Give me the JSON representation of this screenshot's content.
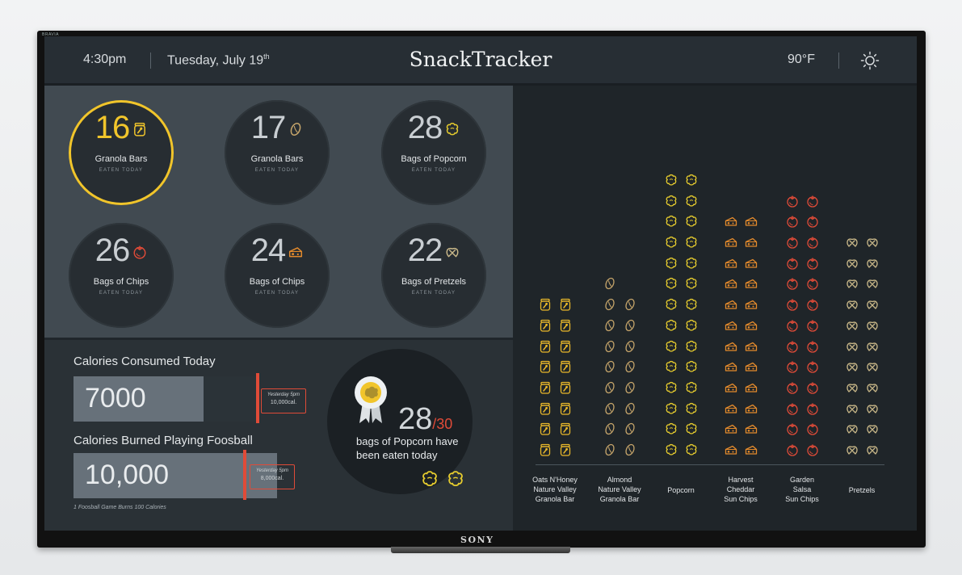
{
  "tv": {
    "model": "BRAVIA",
    "brand": "SONY"
  },
  "header": {
    "time": "4:30pm",
    "date": "Tuesday, July 19",
    "date_suffix": "th",
    "title": "SnackTracker",
    "temperature": "90°F",
    "weather_icon": "sun-icon"
  },
  "counts": [
    {
      "value": "16",
      "label": "Granola Bars",
      "sub": "EATEN TODAY",
      "icon": "jar-icon",
      "color": "#f1c52b",
      "highlight": true
    },
    {
      "value": "17",
      "label": "Granola Bars",
      "sub": "EATEN TODAY",
      "icon": "almond-icon",
      "color": "#c7a66b",
      "highlight": false
    },
    {
      "value": "28",
      "label": "Bags of Popcorn",
      "sub": "EATEN TODAY",
      "icon": "popcorn-icon",
      "color": "#e6cc2e",
      "highlight": false
    },
    {
      "value": "26",
      "label": "Bags of Chips",
      "sub": "EATEN TODAY",
      "icon": "tomato-icon",
      "color": "#e04b38",
      "highlight": false
    },
    {
      "value": "24",
      "label": "Bags of Chips",
      "sub": "EATEN TODAY",
      "icon": "cheese-icon",
      "color": "#e38a2c",
      "highlight": false
    },
    {
      "value": "22",
      "label": "Bags of Pretzels",
      "sub": "EATEN TODAY",
      "icon": "pretzel-icon",
      "color": "#c9b889",
      "highlight": false
    }
  ],
  "calories_consumed": {
    "title": "Calories Consumed Today",
    "value": "7000",
    "fill_fraction": 0.7,
    "note_line1": "Yesterday 5pm",
    "note_line2": "10,000cal."
  },
  "calories_burned": {
    "title": "Calories Burned Playing Foosball",
    "value": "10,000",
    "fill_fraction": 1.0,
    "note_line1": "Yesterday 5pm",
    "note_line2": "8,000cal."
  },
  "foosball_note": "1 Foosball Game Burns 100 Calories",
  "goal": {
    "count": "28",
    "total": "/30",
    "text": "bags of Popcorn have been eaten today",
    "badge_icon": "award-ribbon-icon"
  },
  "chart_data": {
    "type": "bar",
    "categories": [
      "Oats N'Honey Nature Valley Granola Bar",
      "Almond Nature Valley Granola Bar",
      "Popcorn",
      "Harvest Cheddar Sun Chips",
      "Garden Salsa Sun Chips",
      "Pretzels"
    ],
    "category_lines": [
      [
        "Oats N'Honey",
        "Nature Valley",
        "Granola Bar"
      ],
      [
        "Almond",
        "Nature Valley",
        "Granola Bar"
      ],
      [
        "Popcorn"
      ],
      [
        "Harvest",
        "Cheddar",
        "Sun Chips"
      ],
      [
        "Garden",
        "Salsa",
        "Sun Chips"
      ],
      [
        "Pretzels"
      ]
    ],
    "values": [
      16,
      17,
      28,
      24,
      26,
      22
    ],
    "icons": [
      "jar-icon",
      "almond-icon",
      "popcorn-icon",
      "cheese-icon",
      "tomato-icon",
      "pretzel-icon"
    ],
    "colors": [
      "#e9b82a",
      "#c7a66b",
      "#e6cc2e",
      "#e38a2c",
      "#e04b38",
      "#c9b889"
    ]
  }
}
